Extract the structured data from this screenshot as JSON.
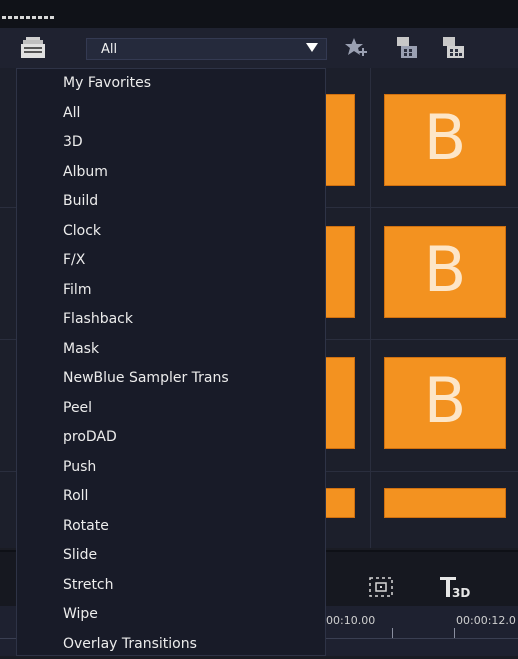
{
  "toolbar": {
    "category_value": "All"
  },
  "menu": {
    "items": [
      "My Favorites",
      "All",
      "3D",
      "Album",
      "Build",
      "Clock",
      "F/X",
      "Film",
      "Flashback",
      "Mask",
      "NewBlue Sampler Trans",
      "Peel",
      "proDAD",
      "Push",
      "Roll",
      "Rotate",
      "Slide",
      "Stretch",
      "Wipe",
      "Overlay Transitions"
    ]
  },
  "thumbnails": {
    "letter": "B"
  },
  "timeline": {
    "time_a": "00:10.00",
    "time_b": "00:00:12.0"
  },
  "colors": {
    "accent_orange": "#f39220",
    "bg_dark": "#1a1c24",
    "menu_bg": "#181b28"
  }
}
